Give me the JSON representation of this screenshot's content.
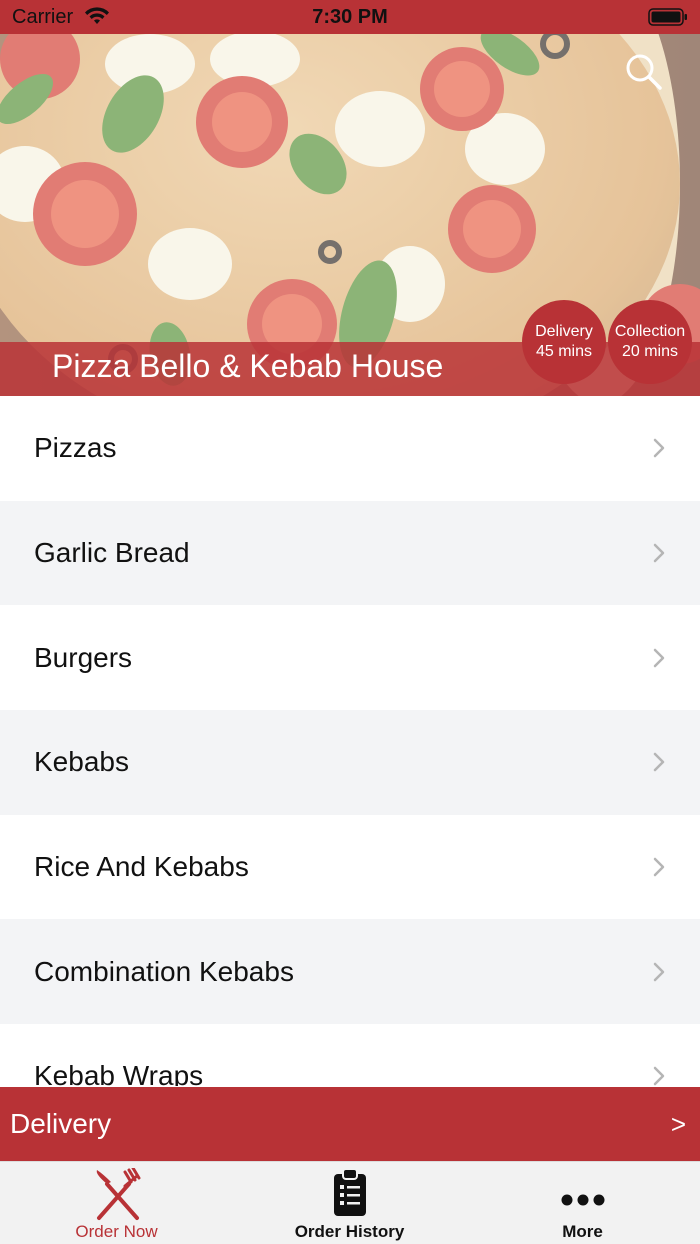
{
  "status_bar": {
    "carrier": "Carrier",
    "time": "7:30 PM"
  },
  "hero": {
    "restaurant_name": "Pizza Bello & Kebab House",
    "badges": [
      {
        "line1": "Delivery",
        "line2": "45 mins"
      },
      {
        "line1": "Collection",
        "line2": "20 mins"
      }
    ]
  },
  "categories": [
    "Pizzas",
    "Garlic Bread",
    "Burgers",
    "Kebabs",
    "Rice And Kebabs",
    "Combination Kebabs",
    "Kebab Wraps"
  ],
  "delivery_bar": {
    "label": "Delivery",
    "arrow": ">"
  },
  "tabs": [
    {
      "label": "Order Now",
      "icon": "fork-knife-icon",
      "active": true
    },
    {
      "label": "Order History",
      "icon": "clipboard-list-icon",
      "active": false
    },
    {
      "label": "More",
      "icon": "more-dots-icon",
      "active": false
    }
  ],
  "colors": {
    "brand_red": "#b83236",
    "list_alt_row": "#f3f4f6",
    "tab_bar_bg": "#f2f2f2"
  }
}
